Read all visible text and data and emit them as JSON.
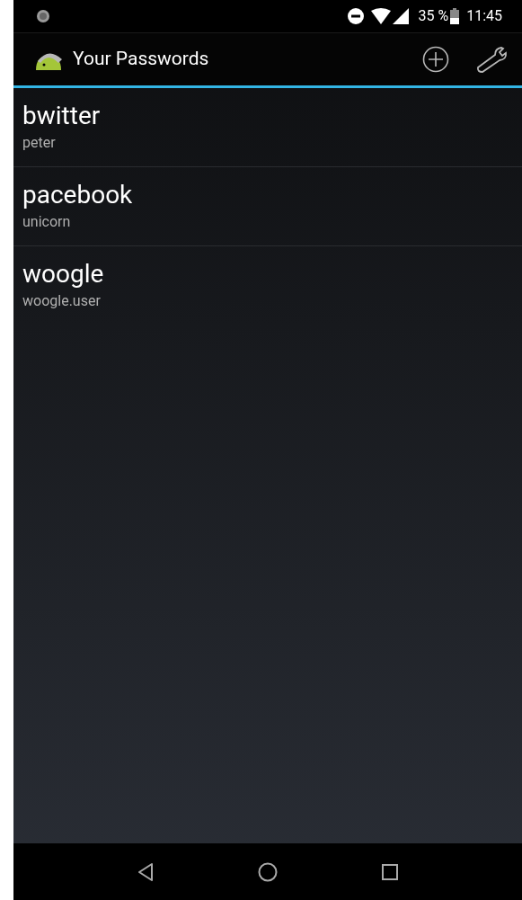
{
  "status_bar": {
    "battery": "35 %",
    "time": "11:45"
  },
  "action_bar": {
    "title": "Your Passwords"
  },
  "entries": [
    {
      "name": "bwitter",
      "user": "peter"
    },
    {
      "name": "pacebook",
      "user": "unicorn"
    },
    {
      "name": "woogle",
      "user": "woogle.user"
    }
  ]
}
